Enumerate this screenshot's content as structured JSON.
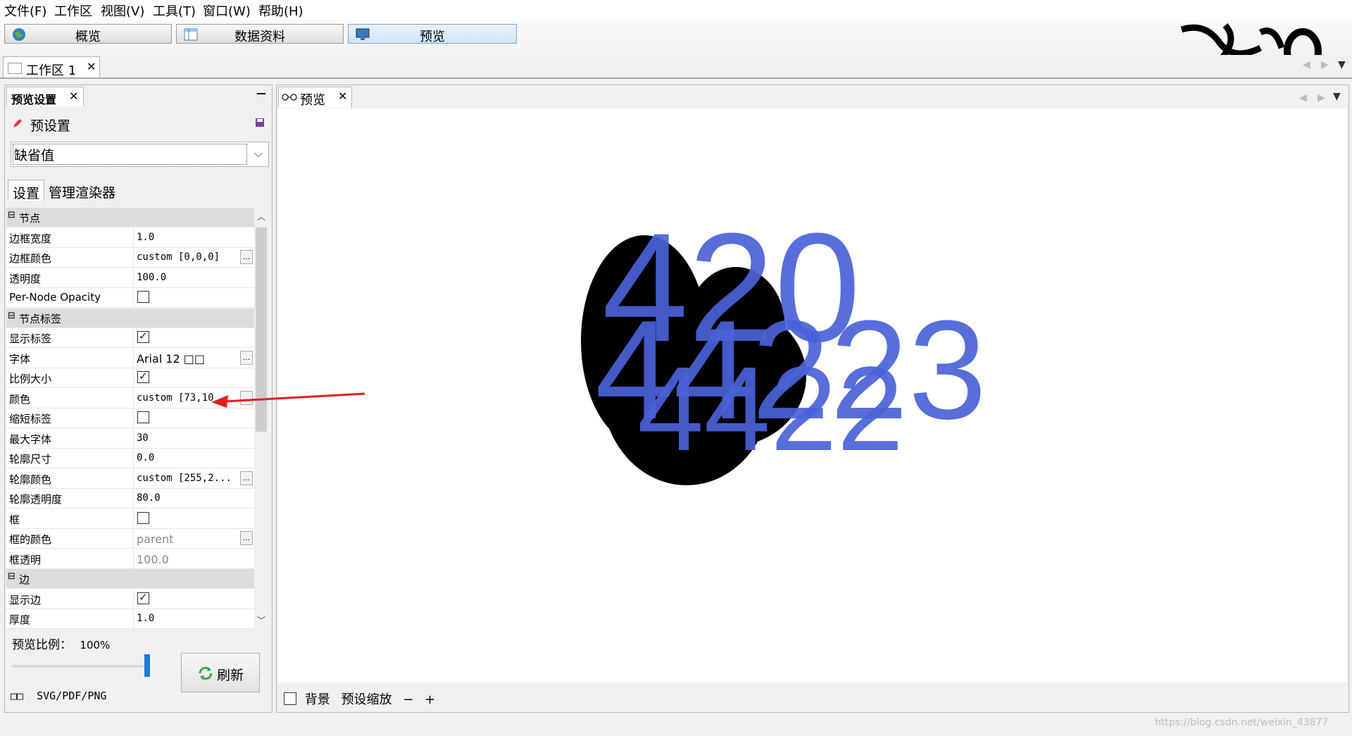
{
  "menu": [
    "文件(F)",
    "工作区",
    "视图(V)",
    "工具(T)",
    "窗口(W)",
    "帮助(H)"
  ],
  "nav": {
    "overview": "概览",
    "data_lab": "数据资料",
    "preview": "预览"
  },
  "workspace_tab": {
    "label": "工作区 1",
    "close": "✕"
  },
  "left_panel": {
    "title": "预览设置",
    "close": "✕",
    "minimize": "—",
    "presets_label": "预设置",
    "preset_value": "缺省值",
    "tabs": [
      "设置",
      "管理渲染器"
    ],
    "zoom_label": "预览比例：",
    "zoom_value": "100%",
    "zoom_fraction": 1.0,
    "refresh": "刷新",
    "export_box": "□□",
    "export_label": "SVG/PDF/PNG"
  },
  "properties": [
    {
      "type": "category",
      "label": "节点"
    },
    {
      "key": "边框宽度",
      "value": "1.0"
    },
    {
      "key": "边框颜色",
      "value": "custom [0,0,0]",
      "ellipsis": true
    },
    {
      "key": "透明度",
      "value": "100.0"
    },
    {
      "key": "Per-Node Opacity",
      "checkbox": false
    },
    {
      "type": "category",
      "label": "节点标签"
    },
    {
      "key": "显示标签",
      "checkbox": true
    },
    {
      "key": "字体",
      "value": "Arial 12 □□",
      "sans": true,
      "ellipsis": true
    },
    {
      "key": "比例大小",
      "checkbox": true
    },
    {
      "key": "颜色",
      "value": "custom [73,10",
      "ellipsis": true
    },
    {
      "key": "缩短标签",
      "checkbox": false
    },
    {
      "key": "最大字体",
      "value": "30"
    },
    {
      "key": "轮廓尺寸",
      "value": "0.0"
    },
    {
      "key": "轮廓颜色",
      "value": "custom [255,2...",
      "ellipsis": true
    },
    {
      "key": "轮廓透明度",
      "value": "80.0"
    },
    {
      "key": "框",
      "checkbox": false
    },
    {
      "key": "框的颜色",
      "value": "parent",
      "sans": true,
      "dim": true,
      "ellipsis": true
    },
    {
      "key": "框透明",
      "value": "100.0",
      "sans": true,
      "dim": true
    },
    {
      "type": "category",
      "label": "边"
    },
    {
      "key": "显示边",
      "checkbox": true
    },
    {
      "key": "厚度",
      "value": "1.0"
    }
  ],
  "preview": {
    "tab": "预览",
    "close": "✕",
    "bottom": {
      "background": "背景",
      "preset_zoom": "预设缩放",
      "minus": "−",
      "plus": "+"
    },
    "label_color": "#4a62d8",
    "labels": [
      "420",
      "44223",
      "4422"
    ]
  },
  "watermark": "https://blog.csdn.net/weixin_43877"
}
